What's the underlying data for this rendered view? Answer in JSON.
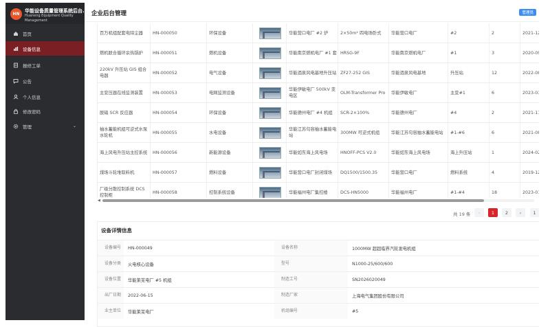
{
  "brand": {
    "logo": "HN",
    "title": "华能设备质量管理系统后台...",
    "subtitle": "Huaneng Equipment Quality Management"
  },
  "nav": [
    {
      "label": "首页",
      "icon": "home-icon"
    },
    {
      "label": "设备信息",
      "icon": "bar-chart-icon"
    },
    {
      "label": "报修工单",
      "icon": "document-icon"
    },
    {
      "label": "公告",
      "icon": "message-icon"
    },
    {
      "label": "个人信息",
      "icon": "user-icon"
    },
    {
      "label": "修改密码",
      "icon": "lock-icon"
    },
    {
      "label": "管理",
      "icon": "gear-icon"
    }
  ],
  "header": {
    "title": "企业后台管理",
    "badge": "管理员"
  },
  "table": {
    "rows": [
      [
        "百万机组配套电除尘器",
        "HN-000050",
        "环保设备",
        "华能营口电厂 #2 炉",
        "2×50m² 四电场卧式",
        "华能营口电厂",
        "#2",
        "2",
        "2021-12"
      ],
      [
        "燃机联合循环余热锅炉",
        "HN-000051",
        "燃机设备",
        "华能南京燃机电厂 #1 套",
        "HRSG-9F",
        "华能南京燃机电厂",
        "#1",
        "3",
        "2020-09"
      ],
      [
        "220kV 升压站 GIS 组合电器",
        "HN-000052",
        "电气设备",
        "华能酒泉风电基地升压站",
        "ZF27-252 GIS",
        "华能酒泉风电基地",
        "升压站",
        "12",
        "2022-08"
      ],
      [
        "主变压器在线监测装置",
        "HN-000053",
        "电网监测设备",
        "华能伊敏电厂 500kV 变电区",
        "OLM-Transformer Pro",
        "华能伊敏电厂",
        "主变#1",
        "6",
        "2023-03"
      ],
      [
        "脱硝 SCR 反应器",
        "HN-000054",
        "环保设备",
        "华能德州电厂 #4 机组",
        "SCR-2×100%",
        "华能德州电厂",
        "#4",
        "2",
        "2021-11"
      ],
      [
        "抽水蓄能机组可逆式水泵水轮机",
        "HN-000055",
        "水电设备",
        "华能江苏句容抽水蓄能电站",
        "300MW 可逆式机组",
        "华能江苏句容抽水蓄能电站",
        "#1-#6",
        "6",
        "2021-08"
      ],
      [
        "海上风电升压站主控系统",
        "HN-000056",
        "新能源设备",
        "华能如东海上风电场",
        "HNOFF-PCS V2.0",
        "华能如东海上风电场",
        "海上升压站",
        "1",
        "2024-02"
      ],
      [
        "煤场斗轮堆取料机",
        "HN-000057",
        "燃料设备",
        "华能营口电厂封闭煤场",
        "DQ1500/1500.35",
        "华能营口电厂",
        "燃料系统",
        "4",
        "2019-12"
      ],
      [
        "厂级分散控制系统 DCS 控制柜",
        "HN-000058",
        "控制系统设备",
        "华能福州电厂集控楼",
        "DCS-HN5000",
        "华能福州电厂",
        "#1-#4",
        "18",
        "2023-01"
      ]
    ]
  },
  "pager": {
    "total": "共 19 条",
    "prev": "‹",
    "p1": "1",
    "p2": "2",
    "next": "›",
    "last": "1"
  },
  "details": {
    "title": "设备详情信息",
    "rows": [
      {
        "l1": "设备编号",
        "v1": "HN-000049",
        "l2": "设备名称",
        "v2": "1000MW 超超临界汽轮发电机组"
      },
      {
        "l1": "设备分类",
        "v1": "火电核心设备",
        "l2": "型号",
        "v2": "N1000-25/600/600"
      },
      {
        "l1": "设备位置",
        "v1": "华能莱芜电厂 #5 机组",
        "l2": "制造工号",
        "v2": "SN2026020049"
      },
      {
        "l1": "出厂日期",
        "v1": "2022-06-15",
        "l2": "制造厂家",
        "v2": "上海电气集团股份有限公司"
      },
      {
        "l1": "业主单位",
        "v1": "华能莱芜电厂",
        "l2": "机组编号",
        "v2": "#5"
      }
    ]
  }
}
